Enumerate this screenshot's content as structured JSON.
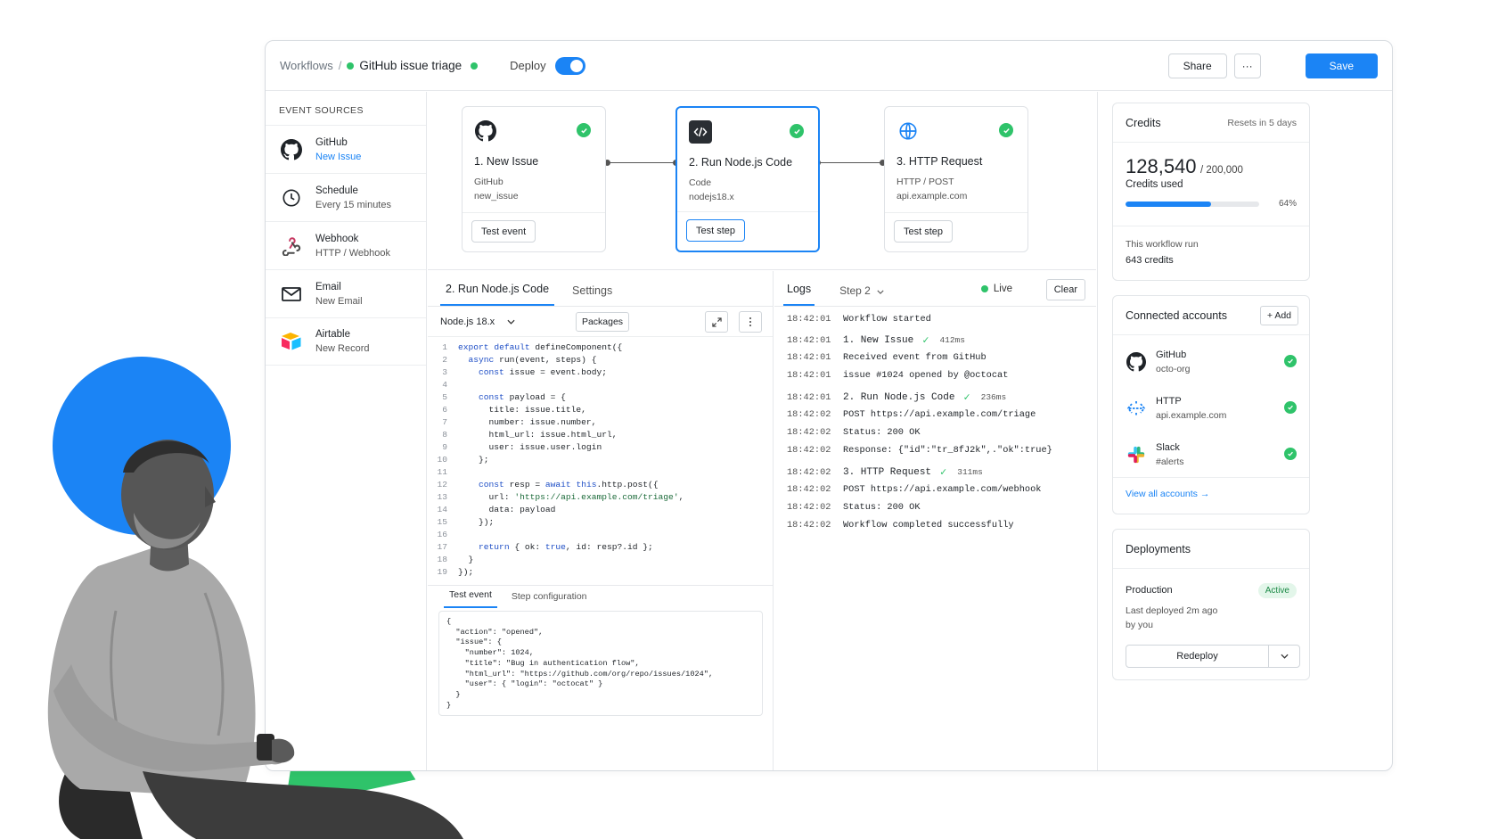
{
  "topbar": {
    "breadcrumb_root": "Workflows",
    "breadcrumb_sep": "/",
    "workflow_name": "GitHub issue triage",
    "deploy_label": "Deploy",
    "deploy_on": true,
    "share_label": "Share",
    "more_label": "···",
    "save_label": "Save"
  },
  "sources": {
    "title": "EVENT SOURCES",
    "items": [
      {
        "name": "GitHub",
        "sub": "New Issue",
        "icon": "github-icon"
      },
      {
        "name": "Schedule",
        "sub": "Every 15 minutes",
        "icon": "clock-icon"
      },
      {
        "name": "Webhook",
        "sub": "HTTP / Webhook",
        "icon": "webhook-icon"
      },
      {
        "name": "Email",
        "sub": "New Email",
        "icon": "mail-icon"
      },
      {
        "name": "Airtable",
        "sub": "New Record",
        "icon": "airtable-icon"
      }
    ]
  },
  "nodes": [
    {
      "title": "1. New Issue",
      "sub1": "GitHub",
      "sub2": "new_issue",
      "button": "Test event",
      "icon": "github-icon"
    },
    {
      "title": "2. Run Node.js Code",
      "sub1": "Code",
      "sub2": "nodejs18.x",
      "button": "Test step",
      "icon": "code-icon"
    },
    {
      "title": "3. HTTP Request",
      "sub1": "HTTP / POST",
      "sub2": "api.example.com",
      "button": "Test step",
      "icon": "globe-icon"
    }
  ],
  "editor": {
    "tab_code": "2. Run Node.js Code",
    "tab_settings": "Settings",
    "runtime": "Node.js 18.x",
    "packages_label": "Packages",
    "bottom_tab_event": "Test event",
    "bottom_tab_config": "Step configuration",
    "code_lines": [
      "export default defineComponent({",
      "  async run(event, steps) {",
      "    const issue = event.body;",
      "",
      "    const payload = {",
      "      title: issue.title,",
      "      number: issue.number,",
      "      html_url: issue.html_url,",
      "      user: issue.user.login",
      "    };",
      "",
      "    const resp = await this.http.post({",
      "      url: 'https://api.example.com/triage',",
      "      data: payload",
      "    });",
      "",
      "    return { ok: true, id: resp?.id };",
      "  }",
      "});"
    ],
    "test_event_json": "{\n  \"action\": \"opened\",\n  \"issue\": {\n    \"number\": 1024,\n    \"title\": \"Bug in authentication flow\",\n    \"html_url\": \"https://github.com/org/repo/issues/1024\",\n    \"user\": { \"login\": \"octocat\" }\n  }\n}"
  },
  "logs": {
    "tab": "Logs",
    "step_select": "Step 2",
    "live_label": "Live",
    "clear_label": "Clear",
    "rows": [
      {
        "time": "18:42:01",
        "msg": "Workflow started"
      },
      {
        "time": "18:42:01",
        "msg": "1. New Issue",
        "ms": "412ms",
        "step": true
      },
      {
        "time": "18:42:01",
        "msg": "Received event from GitHub"
      },
      {
        "time": "18:42:01",
        "msg": "issue #1024 opened by @octocat"
      },
      {
        "time": "18:42:01",
        "msg": "2. Run Node.js Code",
        "ms": "236ms",
        "step": true
      },
      {
        "time": "18:42:02",
        "msg": "POST https://api.example.com/triage"
      },
      {
        "time": "18:42:02",
        "msg": "Status: 200 OK"
      },
      {
        "time": "18:42:02",
        "msg": "Response: {\"id\":\"tr_8fJ2k\",.\"ok\":true}"
      },
      {
        "time": "18:42:02",
        "msg": "3. HTTP Request",
        "ms": "311ms",
        "step": true
      },
      {
        "time": "18:42:02",
        "msg": "POST https://api.example.com/webhook"
      },
      {
        "time": "18:42:02",
        "msg": "Status: 200 OK"
      },
      {
        "time": "18:42:02",
        "msg": "Workflow completed successfully"
      }
    ]
  },
  "credits": {
    "title": "Credits",
    "resets": "Resets in 5 days",
    "used": "128,540",
    "total": "/ 200,000",
    "used_label": "Credits used",
    "percent_label": "64%",
    "percent": 0.64,
    "run_label": "This workflow run",
    "run_value": "643 credits"
  },
  "accounts": {
    "title": "Connected accounts",
    "add_label": "+ Add",
    "items": [
      {
        "name": "GitHub",
        "sub": "octo-org",
        "icon": "github-icon"
      },
      {
        "name": "HTTP",
        "sub": "api.example.com",
        "icon": "http-icon"
      },
      {
        "name": "Slack",
        "sub": "#alerts",
        "icon": "slack-icon"
      }
    ],
    "view_all": "View all accounts →"
  },
  "deployments": {
    "title": "Deployments",
    "env": "Production",
    "status": "Active",
    "last_deployed": "Last deployed 2m ago",
    "by": "by you",
    "redeploy_label": "Redeploy"
  },
  "colors": {
    "accent": "#1b84f5",
    "success": "#2fc36a"
  }
}
